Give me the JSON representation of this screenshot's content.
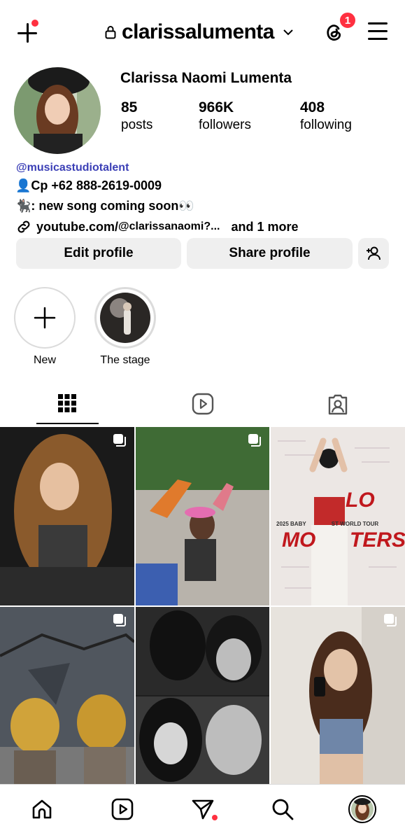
{
  "header": {
    "username": "clarissalumenta",
    "threads_badge": "1"
  },
  "profile": {
    "full_name": "Clarissa Naomi Lumenta",
    "stats": [
      {
        "num": "85",
        "label": "posts"
      },
      {
        "num": "966K",
        "label": "followers"
      },
      {
        "num": "408",
        "label": "following"
      }
    ],
    "mention": "@musicastudiotalent",
    "bio_line1": "👤Cp +62 888-2619-0009",
    "bio_line2": "🐈‍⬛: new song coming soon👀",
    "link_bold": "youtube.com/",
    "link_rest": "@clarissanaomi?...",
    "link_more": "and 1 more"
  },
  "buttons": {
    "edit": "Edit profile",
    "share": "Share profile"
  },
  "highlights": [
    {
      "label": "New"
    },
    {
      "label": "The stage"
    }
  ],
  "grid": {
    "banner_year": "2025 BABY",
    "banner_tour": "ST WORLD TOUR",
    "banner_big1": "LO",
    "banner_big2": "MO",
    "banner_big3": "TERS"
  },
  "colors": {
    "notification": "#ff3040",
    "mention": "#3b3fb6",
    "button_bg": "#efefef"
  },
  "icons": [
    "plus-icon",
    "lock-icon",
    "chevron-down-icon",
    "threads-icon",
    "menu-icon",
    "add-person-icon",
    "grid-icon",
    "reels-icon",
    "tagged-icon",
    "home-icon",
    "reels-nav-icon",
    "direct-icon",
    "search-icon",
    "profile-avatar-icon",
    "multi-post-icon",
    "link-icon"
  ]
}
